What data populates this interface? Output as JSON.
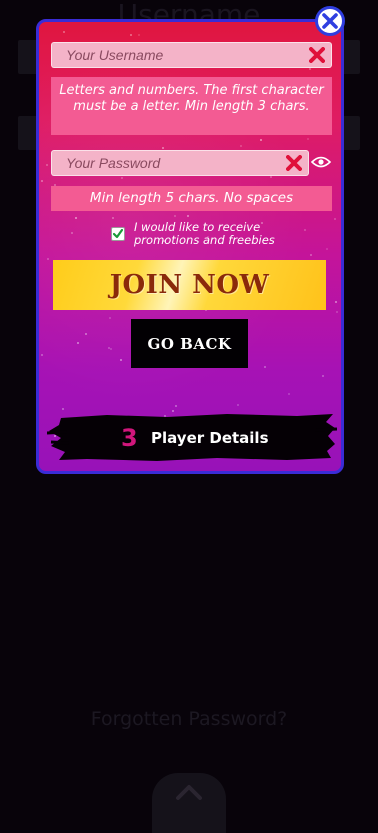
{
  "background": {
    "heading": "Username",
    "forgot_password": "Forgotten Password?",
    "scroll_up_icon": "chevron-up-icon"
  },
  "modal": {
    "close_icon": "close-icon",
    "username": {
      "placeholder": "Your Username",
      "value": "",
      "hint": "Letters and numbers. The first character must be a letter. Min length 3 chars."
    },
    "password": {
      "placeholder": "Your Password",
      "value": "",
      "hint": "Min length 5 chars. No spaces"
    },
    "promotions": {
      "checked": true,
      "label": "I would like to receive promotions and freebies"
    },
    "join_label": "JOIN NOW",
    "back_label": "GO BACK",
    "step": {
      "number": "3",
      "title": "Player Details"
    },
    "colors": {
      "gradient_top": "#e0163f",
      "gradient_bottom": "#9812b8",
      "border": "#3a2cd6",
      "hint_bg": "#f35b93",
      "field_bg": "#f4b3c8",
      "error_icon": "#e0103a",
      "join_gold": "#ffcc1a",
      "join_text": "#8a2a0a"
    }
  }
}
